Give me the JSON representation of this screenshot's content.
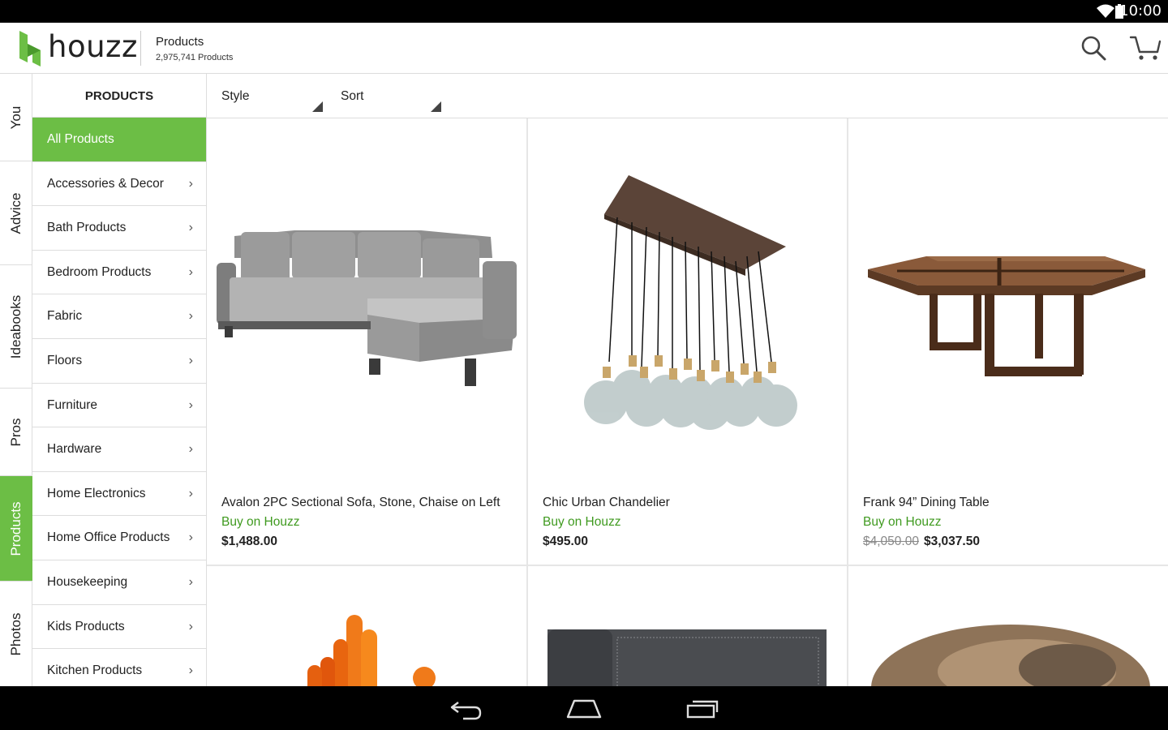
{
  "status_bar": {
    "time": "10:00",
    "wifi_icon": "wifi-icon",
    "battery_icon": "battery-icon"
  },
  "app_bar": {
    "logo_text": "houzz",
    "title": "Products",
    "subtitle": "2,975,741 Products",
    "brand_color": "#6cbe45"
  },
  "rail": {
    "items": [
      {
        "label": "You"
      },
      {
        "label": "Advice"
      },
      {
        "label": "Ideabooks"
      },
      {
        "label": "Pros"
      },
      {
        "label": "Products"
      },
      {
        "label": "Photos"
      }
    ],
    "active": "Products"
  },
  "categories": {
    "header": "PRODUCTS",
    "items": [
      {
        "label": "All Products"
      },
      {
        "label": "Accessories & Decor"
      },
      {
        "label": "Bath Products"
      },
      {
        "label": "Bedroom Products"
      },
      {
        "label": "Fabric"
      },
      {
        "label": "Floors"
      },
      {
        "label": "Furniture"
      },
      {
        "label": "Hardware"
      },
      {
        "label": "Home Electronics"
      },
      {
        "label": "Home Office Products"
      },
      {
        "label": "Housekeeping"
      },
      {
        "label": "Kids Products"
      },
      {
        "label": "Kitchen Products"
      }
    ],
    "active": "All Products",
    "chevron": "›"
  },
  "filters": {
    "style_label": "Style",
    "sort_label": "Sort"
  },
  "products": [
    {
      "name": "Avalon 2PC Sectional Sofa, Stone, Chaise on Left",
      "buy": "Buy on Houzz",
      "price": "$1,488.00"
    },
    {
      "name": "Chic Urban Chandelier",
      "buy": "Buy on Houzz",
      "price": "$495.00"
    },
    {
      "name": "Frank 94” Dining Table",
      "buy": "Buy on Houzz",
      "old_price": "$4,050.00",
      "price": "$3,037.50"
    }
  ],
  "colors": {
    "accent": "#6cbe45",
    "buy_link": "#3f9a1f"
  }
}
